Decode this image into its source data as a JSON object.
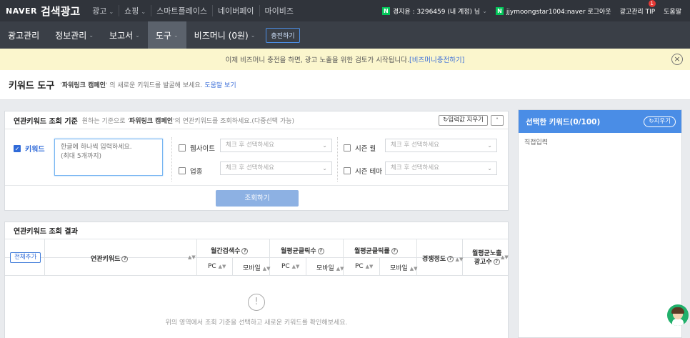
{
  "topbar": {
    "brand": "NAVER",
    "title": "검색광고",
    "nav": [
      {
        "label": "광고",
        "caret": true
      },
      {
        "label": "쇼핑",
        "caret": true
      },
      {
        "label": "스마트플레이스",
        "caret": false
      },
      {
        "label": "네이버페이",
        "caret": false
      },
      {
        "label": "마이비즈",
        "caret": false
      }
    ],
    "account": "경지윤 : 3296459 (내 계정) 님",
    "user": "jjymoongstar1004:naver 로그아웃",
    "tip": "광고관리 TIP",
    "tip_count": "1",
    "help": "도움말"
  },
  "subnav": {
    "items": [
      {
        "label": "광고관리",
        "caret": false,
        "active": false
      },
      {
        "label": "정보관리",
        "caret": true,
        "active": false
      },
      {
        "label": "보고서",
        "caret": true,
        "active": false
      },
      {
        "label": "도구",
        "caret": true,
        "active": true
      },
      {
        "label": "비즈머니 (0원)",
        "caret": true,
        "active": false
      }
    ],
    "charge": "충전하기"
  },
  "notice": {
    "text": "이제 비즈머니 충전을 하면, 광고 노출을 위한 검토가 시작됩니다.",
    "link": "[비즈머니충전하기]"
  },
  "page": {
    "title": "키워드 도구",
    "desc_pre": "'",
    "campaign": "파워링크 캠페인",
    "desc_post": "' 의 새로운 키워드를 발굴해 보세요.",
    "help_link": "도움말 보기"
  },
  "search": {
    "title": "연관키워드 조회 기준",
    "desc_pre": "원하는 기준으로 '",
    "campaign": "파워링크 캠페인",
    "desc_post": "'의 연관키워드를 조회하세요.(다중선택 가능)",
    "reset": "입력값 지우기",
    "keyword_label": "키워드",
    "keyword_placeholder": "한글에 하나씩 입력하세요.\n(최대 5개까지)",
    "website": "웹사이트",
    "industry": "업종",
    "season_month": "시즌 월",
    "season_theme": "시즌 테마",
    "select_placeholder": "체크 후 선택하세요",
    "query_button": "조회하기"
  },
  "results": {
    "title": "연관키워드 조회 결과",
    "add_all": "전체추가",
    "col_keyword": "연관키워드",
    "col_monthly_search": "월간검색수",
    "col_avg_clicks": "월평균클릭수",
    "col_avg_ctr": "월평균클릭률",
    "col_competition": "경쟁정도",
    "col_ads_line1": "월평균노출",
    "col_ads_line2": "광고수",
    "pc": "PC",
    "mobile": "모바일",
    "empty": "위의 영역에서 조회 기준을 선택하고 새로운 키워드를 확인해보세요."
  },
  "selected": {
    "title": "선택한 키워드(0/100)",
    "clear": "지우기",
    "direct_input": "직접입력"
  }
}
